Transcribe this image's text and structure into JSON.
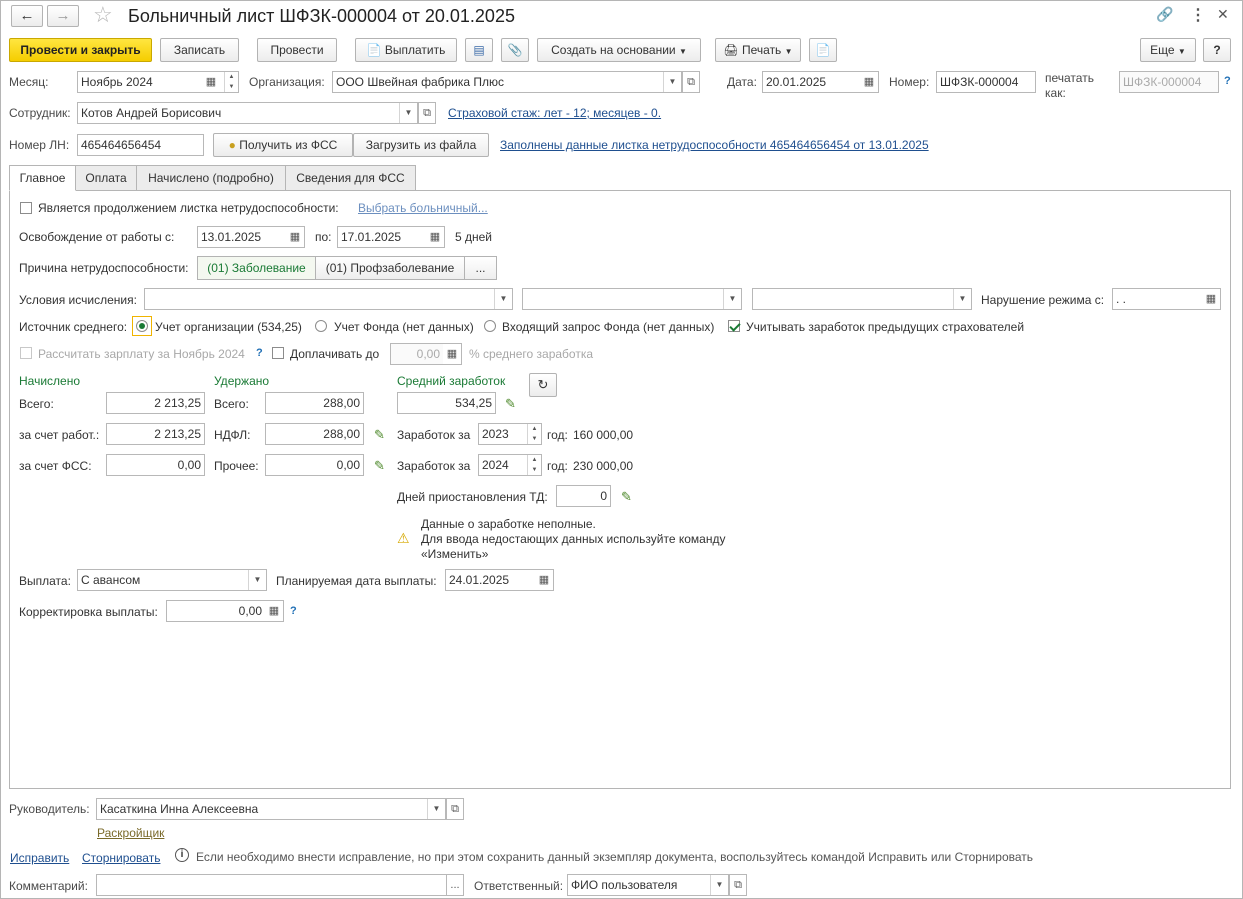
{
  "title": "Больничный лист ШФЗК-000004 от 20.01.2025",
  "toolbar": {
    "post_close": "Провести и закрыть",
    "save": "Записать",
    "post": "Провести",
    "pay": "Выплатить",
    "create_based": "Создать на основании",
    "print": "Печать",
    "more": "Еще",
    "help": "?"
  },
  "header": {
    "month_label": "Месяц:",
    "month_value": "Ноябрь 2024",
    "org_label": "Организация:",
    "org_value": "ООО Швейная фабрика Плюс",
    "date_label": "Дата:",
    "date_value": "20.01.2025",
    "number_label": "Номер:",
    "number_value": "ШФЗК-000004",
    "print_as_label_1": "печатать",
    "print_as_label_2": "как:",
    "print_as_value": "ШФЗК-000004",
    "employee_label": "Сотрудник:",
    "employee_value": "Котов Андрей Борисович",
    "insurance_link": "Страховой стаж: лет - 12; месяцев - 0.",
    "ln_label": "Номер ЛН:",
    "ln_value": "465464656454",
    "get_fss": "Получить из ФСС",
    "load_file": "Загрузить из файла",
    "filled_link": "Заполнены данные листка нетрудоспособности 465464656454 от 13.01.2025"
  },
  "tabs": [
    "Главное",
    "Оплата",
    "Начислено (подробно)",
    "Сведения для ФСС"
  ],
  "main": {
    "continuation_label": "Является продолжением листка нетрудоспособности:",
    "choose_sick_link": "Выбрать больничный...",
    "release_label": "Освобождение от работы с:",
    "release_from": "13.01.2025",
    "release_to_label": "по:",
    "release_to": "17.01.2025",
    "days": "5 дней",
    "reason_label": "Причина нетрудоспособности:",
    "reason_opt1": "(01) Заболевание",
    "reason_opt2": "(01) Профзаболевание",
    "reason_more": "...",
    "conditions_label": "Условия исчисления:",
    "violation_label": "Нарушение режима с:",
    "violation_value": " .  .",
    "source_label": "Источник среднего:",
    "source_opt1": "Учет организации (534,25)",
    "source_opt2": "Учет Фонда (нет данных)",
    "source_opt3": "Входящий запрос Фонда (нет данных)",
    "prev_employers": "Учитывать заработок предыдущих страхователей",
    "calc_salary": "Рассчитать зарплату за Ноябрь 2024",
    "pay_extra": "Доплачивать до",
    "pay_extra_value": "0,00",
    "pay_extra_suffix": "% среднего заработка",
    "accrued_head": "Начислено",
    "withheld_head": "Удержано",
    "avg_head": "Средний заработок",
    "total_label": "Всего:",
    "accrued_total": "2 213,25",
    "withheld_total_label": "Всего:",
    "withheld_total": "288,00",
    "avg_value": "534,25",
    "employer_label": "за счет работ.:",
    "employer_value": "2 213,25",
    "ndfl_label": "НДФЛ:",
    "ndfl_value": "288,00",
    "earnings_label1": "Заработок за",
    "year1": "2023",
    "year1_suffix": "год:",
    "year1_amount": "160 000,00",
    "fss_label": "за счет ФСС:",
    "fss_value": "0,00",
    "other_label": "Прочее:",
    "other_value": "0,00",
    "earnings_label2": "Заработок за",
    "year2": "2024",
    "year2_suffix": "год:",
    "year2_amount": "230 000,00",
    "suspend_label": "Дней приостановления ТД:",
    "suspend_value": "0",
    "warn1": "Данные о заработке неполные.",
    "warn2": "Для ввода недостающих данных используйте команду",
    "warn3": "«Изменить»",
    "payout_label": "Выплата:",
    "payout_value": "С авансом",
    "planned_label": "Планируемая дата выплаты:",
    "planned_value": "24.01.2025",
    "correction_label": "Корректировка выплаты:",
    "correction_value": "0,00"
  },
  "footer": {
    "manager_label": "Руководитель:",
    "manager_value": "Касаткина Инна Алексеевна",
    "manager_position": "Раскройщик",
    "fix_link": "Исправить",
    "reverse_link": "Сторнировать",
    "info_text": "Если необходимо внести исправление, но при этом сохранить данный экземпляр документа, воспользуйтесь командой Исправить или Сторнировать",
    "comment_label": "Комментарий:",
    "comment_value": "",
    "comment_more": "...",
    "responsible_label": "Ответственный:",
    "responsible_value": "ФИО пользователя"
  },
  "colors": {
    "accent_yellow": "#f5cd00",
    "green_text": "#1a7a35",
    "link_blue": "#1f4f8f"
  }
}
